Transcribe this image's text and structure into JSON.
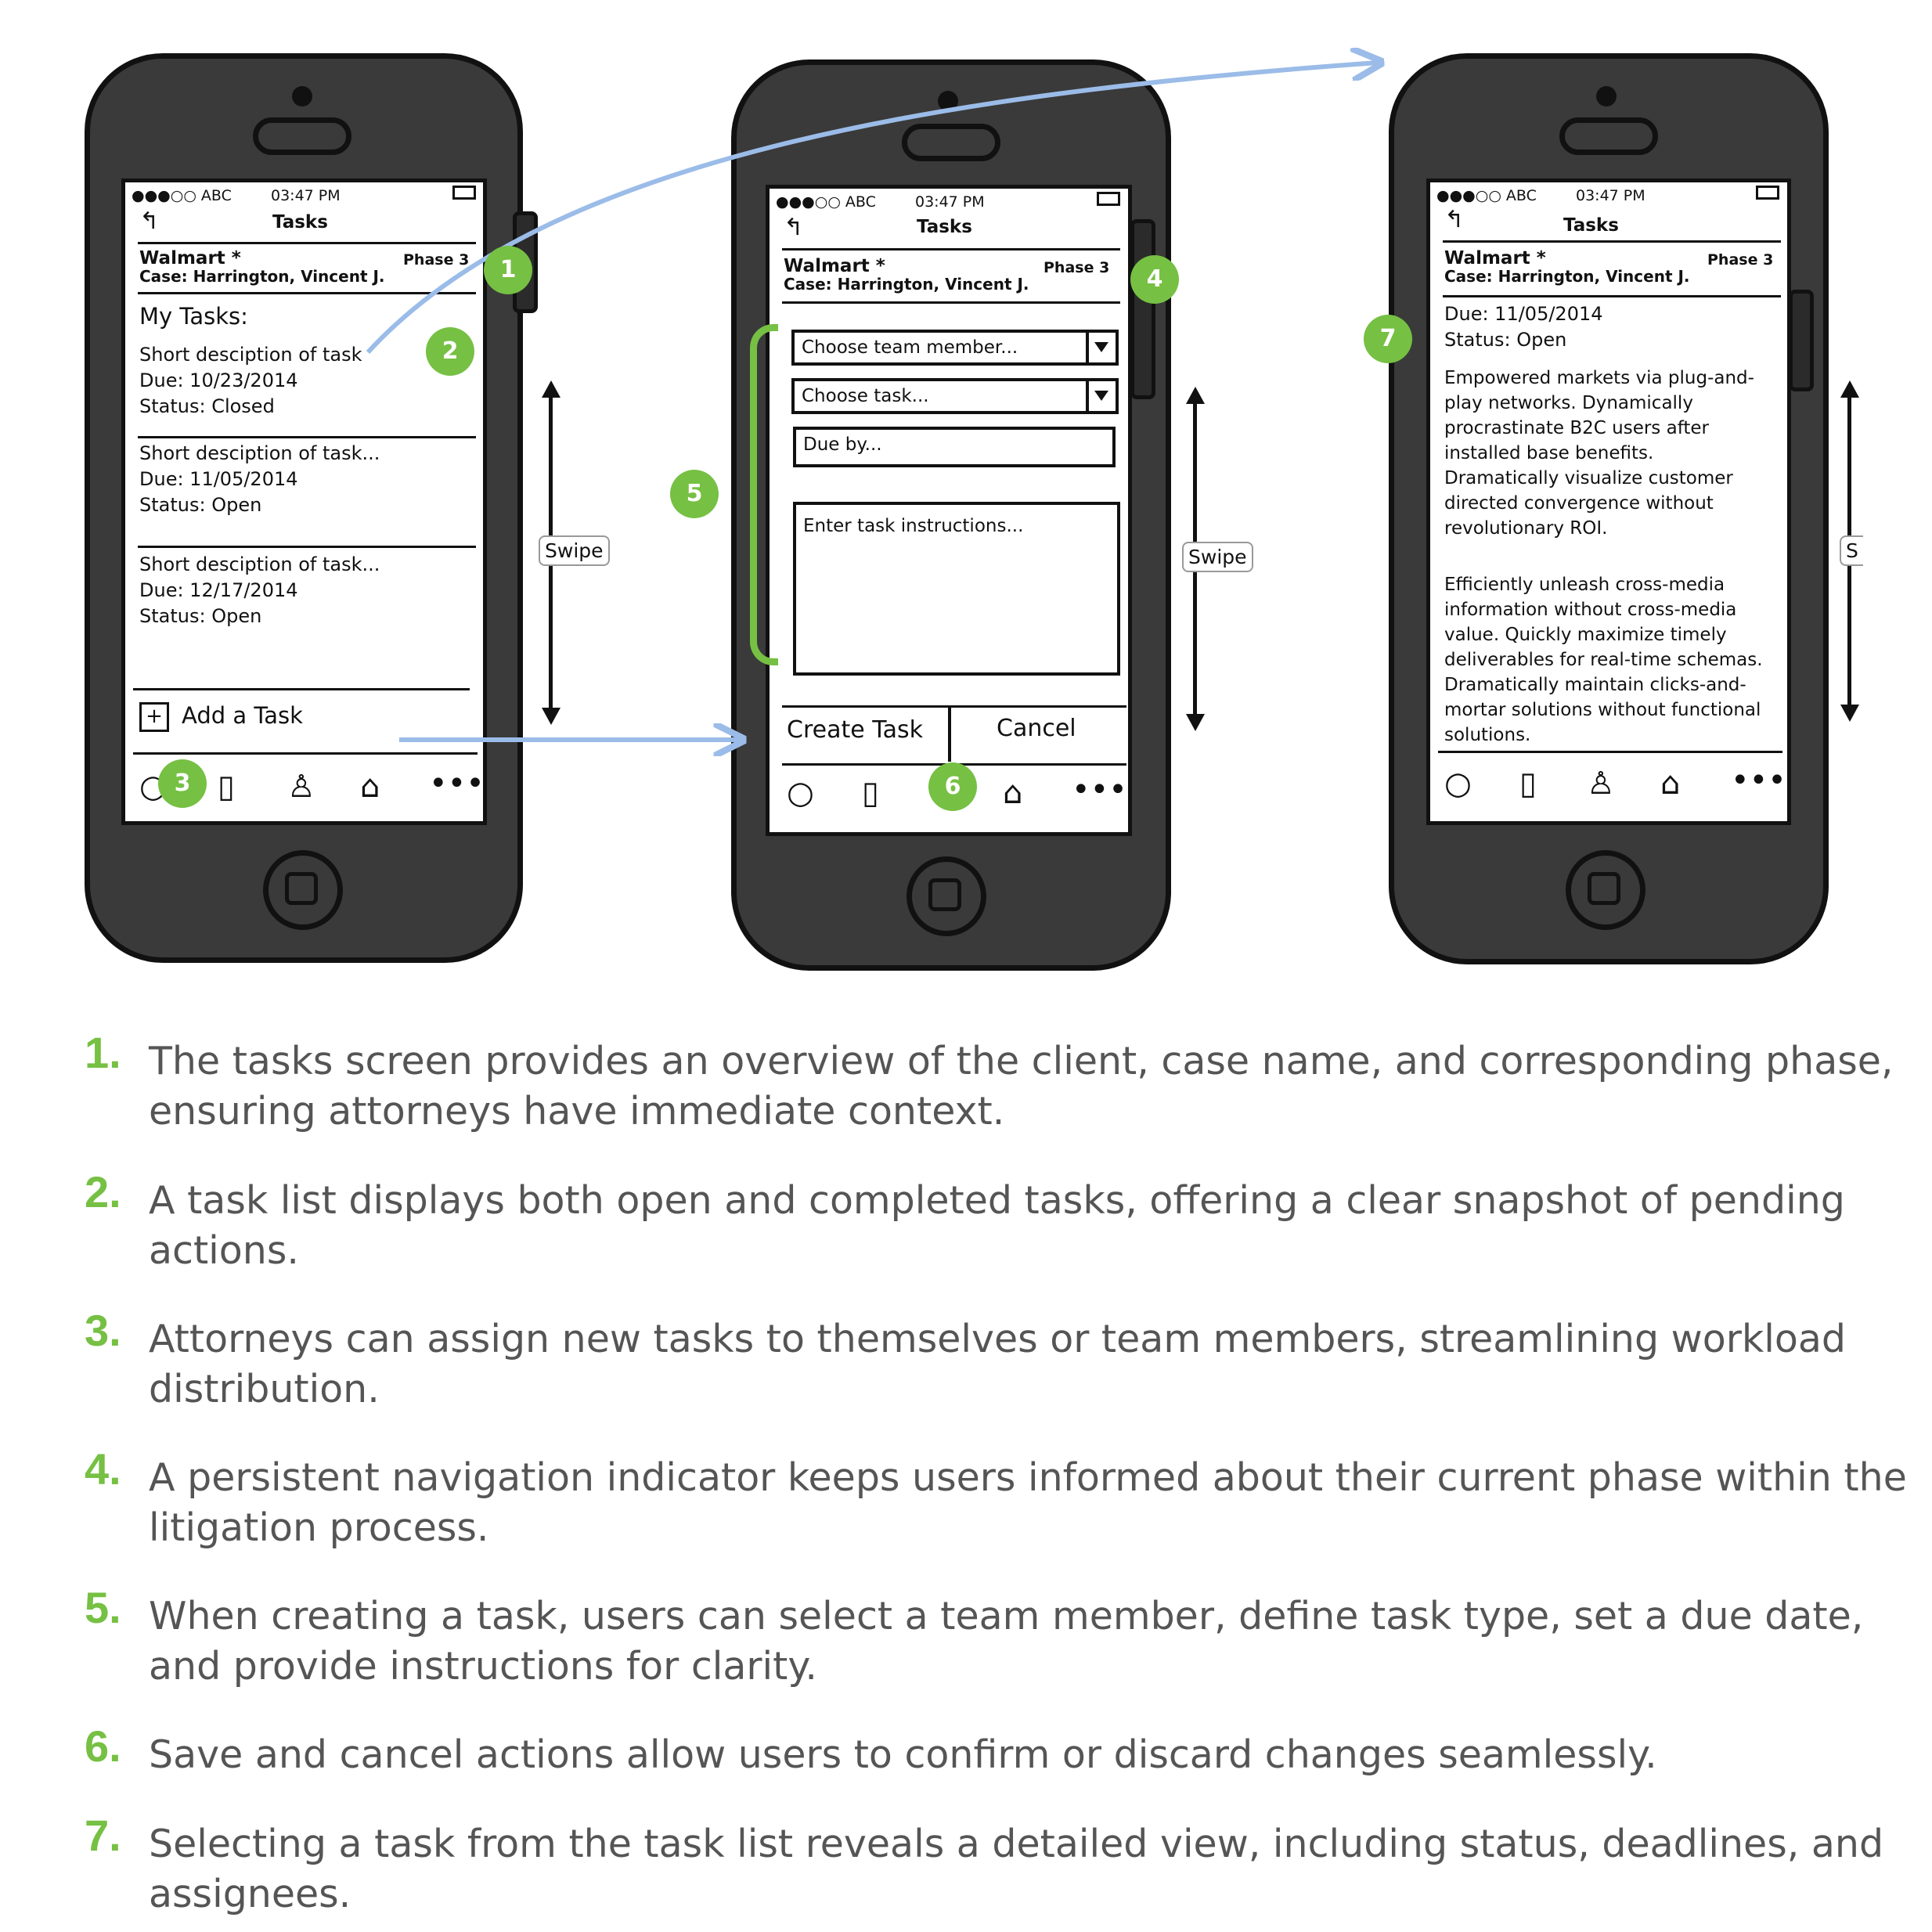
{
  "screens": {
    "list": {
      "status": {
        "carrier": "●●●○○ ABC",
        "time": "03:47 PM"
      },
      "title": "Tasks",
      "client": "Walmart *",
      "case": "Case: Harrington, Vincent J.",
      "phase": "Phase 3",
      "heading": "My Tasks:",
      "tasks": [
        {
          "desc": "Short desciption of task",
          "due": "Due: 10/23/2014",
          "status": "Status: Closed"
        },
        {
          "desc": "Short desciption of task...",
          "due": "Due: 11/05/2014",
          "status": "Status: Open"
        },
        {
          "desc": "Short desciption of task...",
          "due": "Due: 12/17/2014",
          "status": "Status: Open"
        }
      ],
      "add_task": "Add a Task"
    },
    "create": {
      "status": {
        "carrier": "●●●○○ ABC",
        "time": "03:47 PM"
      },
      "title": "Tasks",
      "client": "Walmart *",
      "case": "Case: Harrington, Vincent J.",
      "phase": "Phase 3",
      "team_member_placeholder": "Choose team member...",
      "task_placeholder": "Choose task...",
      "due_placeholder": "Due by...",
      "instructions_placeholder": "Enter task instructions...",
      "create_label": "Create Task",
      "cancel_label": "Cancel"
    },
    "detail": {
      "status": {
        "carrier": "●●●○○ ABC",
        "time": "03:47 PM"
      },
      "title": "Tasks",
      "client": "Walmart *",
      "case": "Case: Harrington, Vincent J.",
      "phase": "Phase 3",
      "due": "Due: 11/05/2014",
      "status_text": "Status: Open",
      "para1": [
        "Empowered markets via plug-and-",
        "play networks. Dynamically",
        "procrastinate B2C users after",
        "installed base benefits.",
        "Dramatically visualize customer",
        "directed convergence without",
        "revolutionary ROI."
      ],
      "para2": [
        "Efficiently unleash cross-media",
        "information without cross-media",
        "value. Quickly maximize timely",
        "deliverables for real-time schemas.",
        "Dramatically maintain clicks-and-",
        "mortar solutions without functional",
        "solutions."
      ]
    }
  },
  "swipe_label": "Swipe",
  "swipe_label_cut": "S",
  "nav_icons": [
    "chat-bubble-icon",
    "document-icon",
    "person-icon",
    "home-icon",
    "more-icon"
  ],
  "badges": [
    "1",
    "2",
    "3",
    "4",
    "5",
    "6",
    "7"
  ],
  "notes": [
    {
      "num": "1.",
      "text": "The tasks screen provides an overview of the client, case name, and corresponding phase, ensuring attorneys have immediate context."
    },
    {
      "num": "2.",
      "text": "A task list displays both open and completed tasks, offering a clear snapshot of pending actions."
    },
    {
      "num": "3.",
      "text": "Attorneys can assign new tasks to themselves or team members, streamlining workload distribution."
    },
    {
      "num": "4.",
      "text": "A persistent navigation indicator keeps users informed about their current phase within the litigation process."
    },
    {
      "num": "5.",
      "text": "When creating a task, users can select a team member, define task type, set a due date, and provide instructions for clarity."
    },
    {
      "num": "6.",
      "text": "Save and cancel actions allow users to confirm or discard changes seamlessly."
    },
    {
      "num": "7.",
      "text": "Selecting a task from the task list reveals a detailed view, including status, deadlines, and assignees."
    }
  ],
  "colors": {
    "accent_green": "#76c043",
    "arrow_blue": "#9bbce8",
    "phone_body": "#3a3a3a",
    "note_text": "#555555"
  }
}
